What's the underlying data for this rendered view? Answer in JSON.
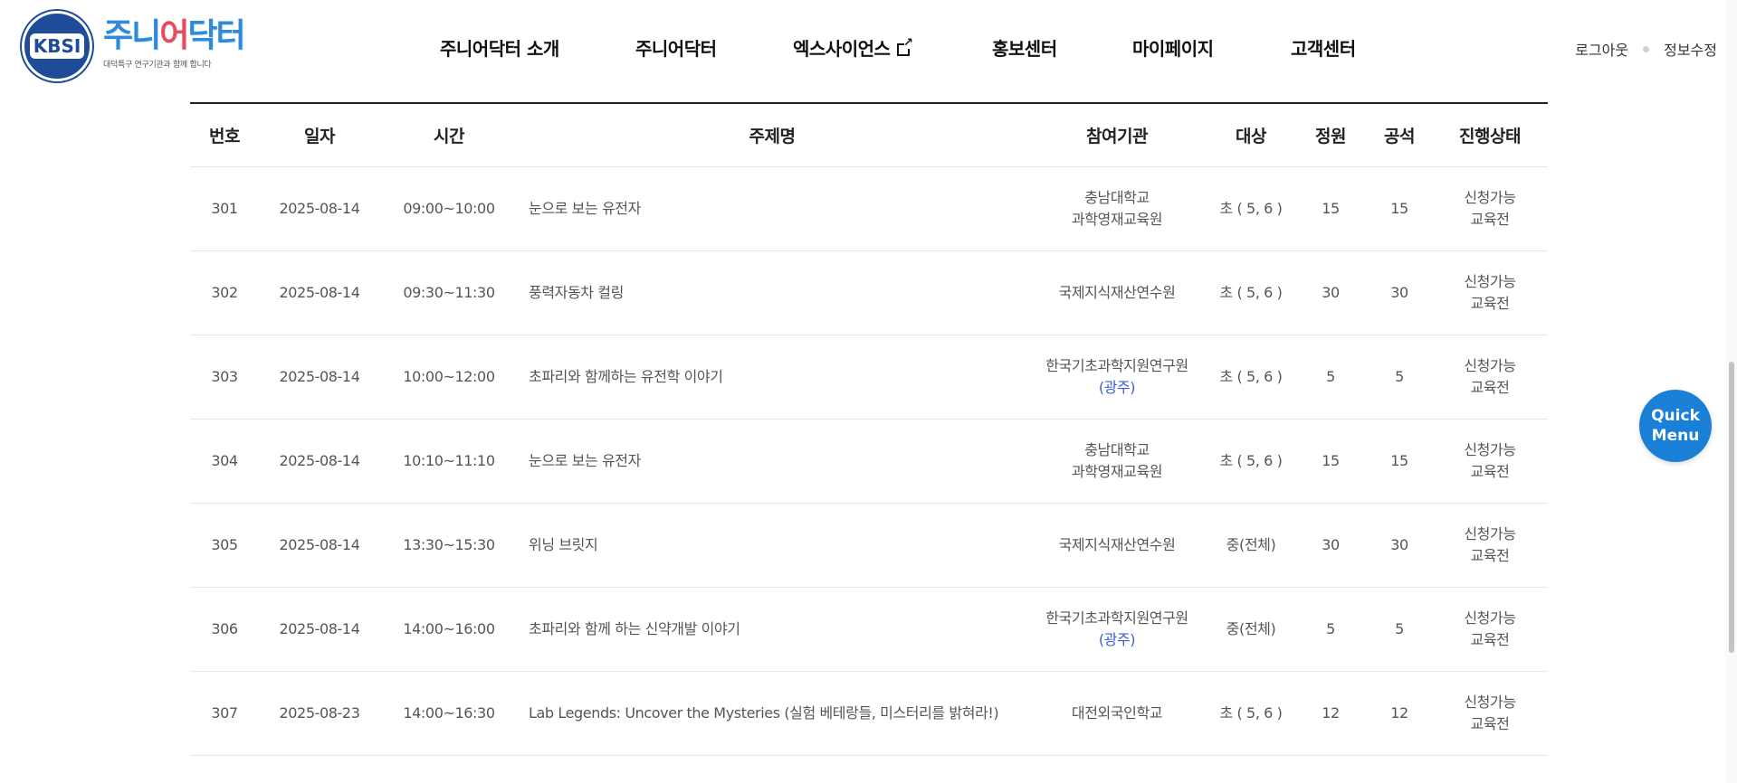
{
  "header": {
    "logo_text": "KBSI",
    "brand_title_a": "주니",
    "brand_title_b": "어",
    "brand_title_c": "닥터",
    "brand_subtitle": "대덕특구 연구기관과 함께 합니다",
    "nav": [
      "주니어닥터 소개",
      "주니어닥터",
      "엑스사이언스",
      "홍보센터",
      "마이페이지",
      "고객센터"
    ],
    "util_logout": "로그아웃",
    "util_edit": "정보수정"
  },
  "table": {
    "headers": [
      "번호",
      "일자",
      "시간",
      "주제명",
      "참여기관",
      "대상",
      "정원",
      "공석",
      "진행상태"
    ],
    "rows": [
      {
        "no": "301",
        "date": "2025-08-14",
        "time": "09:00~10:00",
        "title": "눈으로 보는 유전자",
        "org1": "충남대학교",
        "org2": "과학영재교육원",
        "target": "초 ( 5, 6 )",
        "cap": "15",
        "vac": "15",
        "status1": "신청가능",
        "status2": "교육전"
      },
      {
        "no": "302",
        "date": "2025-08-14",
        "time": "09:30~11:30",
        "title": "풍력자동차 컬링",
        "org1": "국제지식재산연수원",
        "org2": "",
        "target": "초 ( 5, 6 )",
        "cap": "30",
        "vac": "30",
        "status1": "신청가능",
        "status2": "교육전"
      },
      {
        "no": "303",
        "date": "2025-08-14",
        "time": "10:00~12:00",
        "title": "초파리와 함께하는 유전학 이야기",
        "org1": "한국기초과학지원연구원",
        "org2": "(광주)",
        "target": "초 ( 5, 6 )",
        "cap": "5",
        "vac": "5",
        "status1": "신청가능",
        "status2": "교육전"
      },
      {
        "no": "304",
        "date": "2025-08-14",
        "time": "10:10~11:10",
        "title": "눈으로 보는 유전자",
        "org1": "충남대학교",
        "org2": "과학영재교육원",
        "target": "초 ( 5, 6 )",
        "cap": "15",
        "vac": "15",
        "status1": "신청가능",
        "status2": "교육전"
      },
      {
        "no": "305",
        "date": "2025-08-14",
        "time": "13:30~15:30",
        "title": "위닝 브릿지",
        "org1": "국제지식재산연수원",
        "org2": "",
        "target": "중(전체)",
        "cap": "30",
        "vac": "30",
        "status1": "신청가능",
        "status2": "교육전"
      },
      {
        "no": "306",
        "date": "2025-08-14",
        "time": "14:00~16:00",
        "title": "초파리와 함께 하는 신약개발 이야기",
        "org1": "한국기초과학지원연구원",
        "org2": "(광주)",
        "target": "중(전체)",
        "cap": "5",
        "vac": "5",
        "status1": "신청가능",
        "status2": "교육전"
      },
      {
        "no": "307",
        "date": "2025-08-23",
        "time": "14:00~16:30",
        "title": "Lab Legends: Uncover the Mysteries (실험 베테랑들, 미스터리를 밝혀라!)",
        "org1": "대전외국인학교",
        "org2": "",
        "target": "초 ( 5, 6 )",
        "cap": "12",
        "vac": "12",
        "status1": "신청가능",
        "status2": "교육전"
      }
    ]
  },
  "quick_menu": {
    "line1": "Quick",
    "line2": "Menu"
  },
  "colors": {
    "accent": "#1a7fd6",
    "org_paren": "#3e5bd8",
    "kbsi_blue": "#1f4c98"
  }
}
